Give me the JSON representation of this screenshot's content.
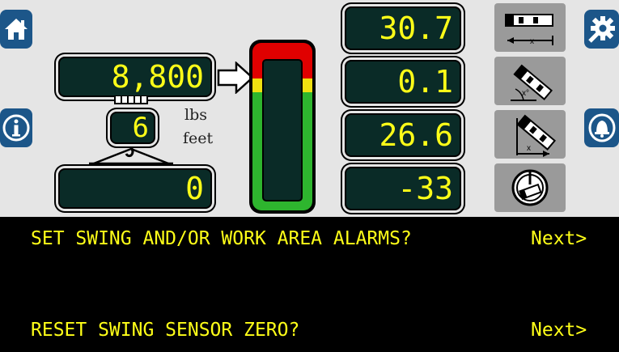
{
  "main_weight": {
    "value": "8,800",
    "unit": "lbs"
  },
  "parts_of_line": {
    "value": "6",
    "unit": "feet"
  },
  "hook_value": {
    "value": "0"
  },
  "readings": [
    {
      "value": "30.7"
    },
    {
      "value": "0.1"
    },
    {
      "value": "26.6"
    },
    {
      "value": "-33"
    }
  ],
  "load_meter": {
    "level": 0.0,
    "zone_colors": [
      "#2eb52e",
      "#f0e010",
      "#e00000"
    ]
  },
  "prompts": [
    {
      "text": "SET SWING AND/OR WORK AREA ALARMS?",
      "action": "Next>"
    },
    {
      "text": "RESET SWING SENSOR ZERO?",
      "action": "Next>"
    }
  ],
  "icons": {
    "left": [
      "home-icon",
      "info-icon"
    ],
    "right": [
      "gear-icon",
      "bell-icon"
    ],
    "gray": [
      "boom-length-icon",
      "boom-angle-icon",
      "boom-radius-icon",
      "swing-angle-icon"
    ]
  },
  "colors": {
    "lcd_bg": "#0a2b27",
    "lcd_text": "#ffff18",
    "button_blue": "#1c5689",
    "panel_bg": "#e5e5e5"
  }
}
